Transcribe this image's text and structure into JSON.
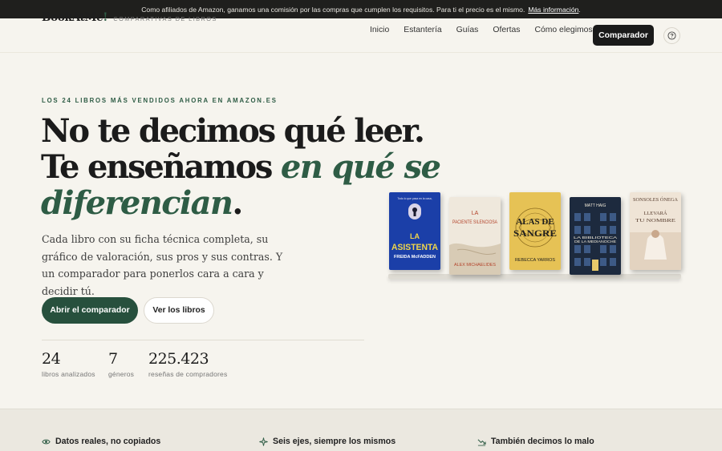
{
  "topbar": {
    "text": "Como afiliados de Amazon, ganamos una comisión por las compras que cumplen los requisitos. Para ti el precio es el mismo.",
    "link": "Más información",
    "end": "."
  },
  "brand": {
    "name": "BookAtMe",
    "bang": "!",
    "subtitle": "COMPARATIVAS DE LIBROS"
  },
  "nav": {
    "links": [
      "Inicio",
      "Estantería",
      "Guías",
      "Ofertas",
      "Cómo elegimos"
    ],
    "cta": "Comparador",
    "help_icon": "question-circle-icon"
  },
  "hero": {
    "eyebrow": "LOS 24 LIBROS MÁS VENDIDOS AHORA EN AMAZON.ES",
    "line1": "No te decimos qué leer.",
    "line2_plain": "Te enseñamos ",
    "line2_accent": "en qué se",
    "line3_accent": "diferencian",
    "line3_end": ".",
    "description": "Cada libro con su ficha técnica completa, su gráfico de valoración, sus pros y sus contras. Y un comparador para ponerlos cara a cara y decidir tú.",
    "primary_button": "Abrir el comparador",
    "secondary_button": "Ver los libros"
  },
  "stats": [
    {
      "value": "24",
      "label": "libros analizados"
    },
    {
      "value": "7",
      "label": "géneros"
    },
    {
      "value": "225.423",
      "label": "reseñas de compradores"
    }
  ],
  "books": [
    {
      "top": "Todo lo que pasa en la casa,",
      "title1": "LA",
      "title2": "ASISTENTA",
      "author": "FREIDA McFADDEN",
      "bg": "#1b3fa8",
      "fg": "#f1d64a"
    },
    {
      "top": "",
      "title1": "LA",
      "title2": "PACIENTE SILENCIOSA",
      "author": "ALEX MICHAELIDES",
      "bg": "#efe8dc",
      "fg": "#b3432b"
    },
    {
      "top": "",
      "title1": "ALAS DE",
      "title2": "SANGRE",
      "author": "REBECCA YARROS",
      "bg": "#e6c255",
      "fg": "#1d1d1d"
    },
    {
      "top": "MATT HAIG",
      "title1": "LA BIBLIOTECA",
      "title2": "DE LA MEDIANOCHE",
      "author": "",
      "bg": "#1d2a3e",
      "fg": "#f0e9d8"
    },
    {
      "top": "SONSOLES ÓNEGA",
      "title1": "LLEVARÁ",
      "title2": "TU NOMBRE",
      "author": "",
      "bg": "#efe4d6",
      "fg": "#5a4032"
    }
  ],
  "features": [
    {
      "icon": "eye-icon",
      "label": "Datos reales, no copiados"
    },
    {
      "icon": "sparkle-icon",
      "label": "Seis ejes, siempre los mismos"
    },
    {
      "icon": "trend-down-icon",
      "label": "También decimos lo malo"
    }
  ],
  "colors": {
    "accent": "#2e5c45",
    "dark": "#1a1a1a",
    "background": "#f6f4ee"
  }
}
